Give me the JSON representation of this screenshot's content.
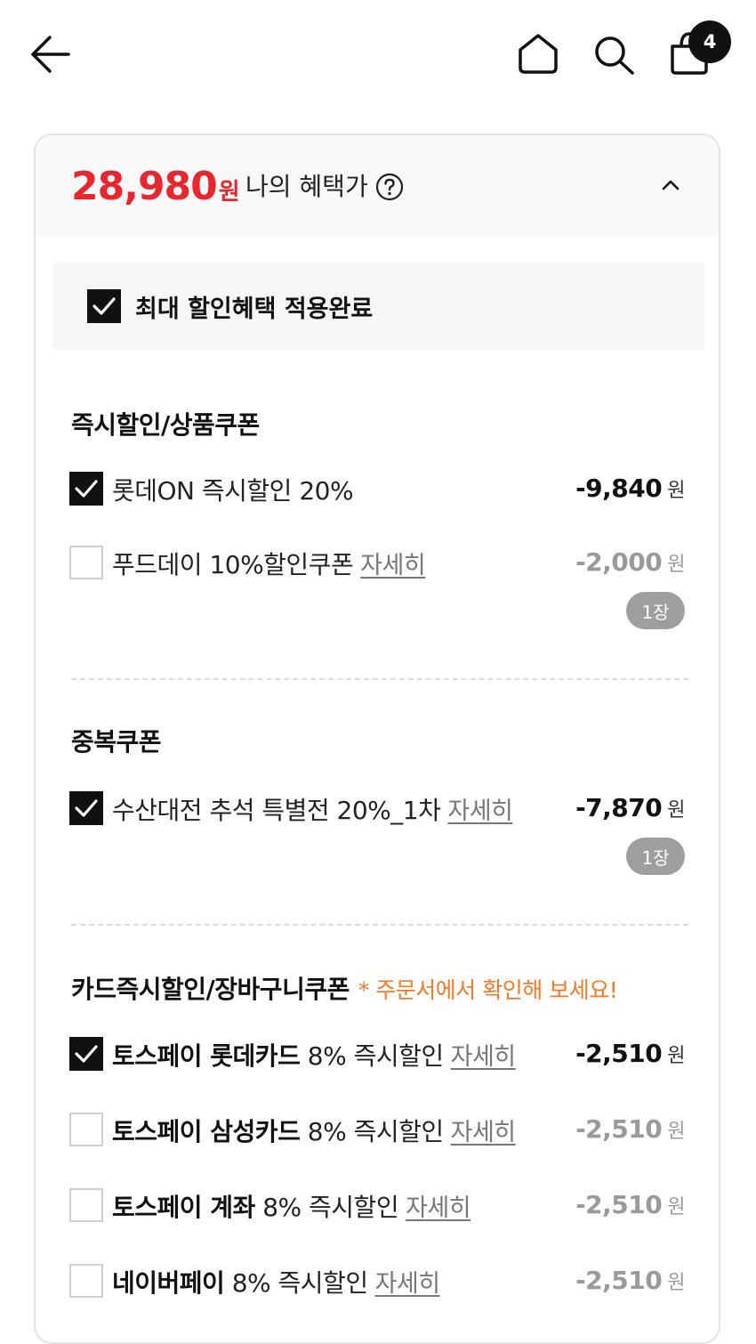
{
  "header": {
    "back_icon": "arrow-left-icon",
    "home_icon": "home-icon",
    "search_icon": "search-icon",
    "cart_icon": "shopping-bag-icon",
    "cart_count": "4"
  },
  "benefit": {
    "price": "28,980",
    "price_unit": "원",
    "label": "나의 혜택가",
    "applied_label": "최대 할인혜택 적용완료",
    "applied_checked": true
  },
  "sections": {
    "instant": {
      "title": "즉시할인/상품쿠폰",
      "rows": [
        {
          "label": "롯데ON 즉시할인 20%",
          "amount": "-9,840",
          "unit": "원",
          "checked": true
        },
        {
          "label": "푸드데이 10%할인쿠폰",
          "detail": "자세히",
          "amount": "-2,000",
          "unit": "원",
          "checked": false,
          "badge": "1장"
        }
      ]
    },
    "duplicate": {
      "title": "중복쿠폰",
      "rows": [
        {
          "label": "수산대전 추석 특별전 20%_1차",
          "detail": "자세히",
          "amount": "-7,870",
          "unit": "원",
          "checked": true,
          "badge": "1장"
        }
      ]
    },
    "card": {
      "title": "카드즉시할인/장바구니쿠폰",
      "notice": "* 주문서에서 확인해 보세요!",
      "rows": [
        {
          "bold": "토스페이 롯데카드",
          "label": "8% 즉시할인",
          "detail": "자세히",
          "amount": "-2,510",
          "unit": "원",
          "checked": true
        },
        {
          "bold": "토스페이 삼성카드",
          "label": "8% 즉시할인",
          "detail": "자세히",
          "amount": "-2,510",
          "unit": "원",
          "checked": false
        },
        {
          "bold": "토스페이 계좌",
          "label": "8% 즉시할인",
          "detail": "자세히",
          "amount": "-2,510",
          "unit": "원",
          "checked": false
        },
        {
          "bold": "네이버페이",
          "label": "8% 즉시할인",
          "detail": "자세히",
          "amount": "-2,510",
          "unit": "원",
          "checked": false
        }
      ]
    }
  },
  "colors": {
    "price": "#e8262e",
    "notice": "#f07a2a",
    "badge": "#9e9e9e"
  }
}
